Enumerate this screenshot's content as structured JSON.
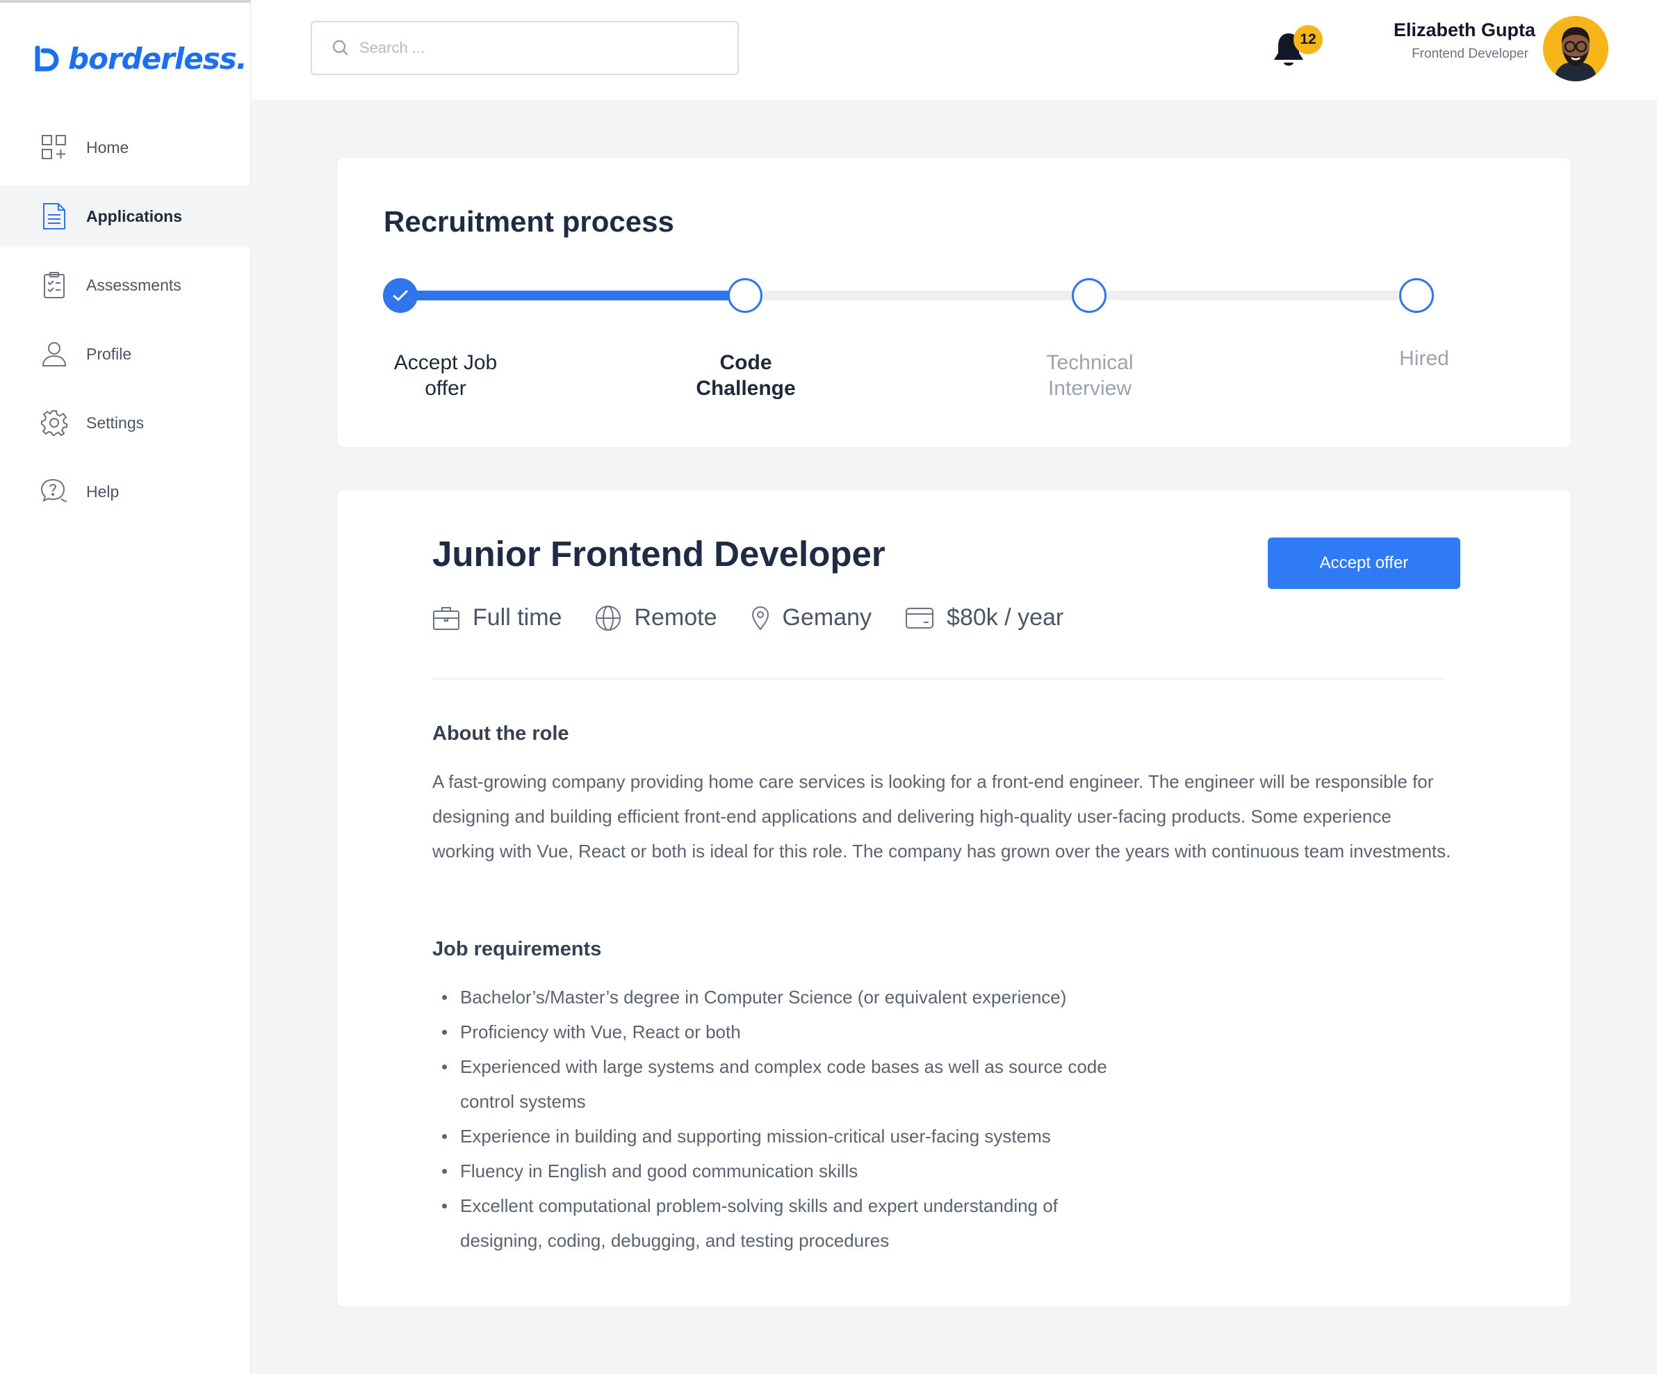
{
  "brand": {
    "name": "borderless.",
    "color": "#1d6ff2"
  },
  "search": {
    "placeholder": "Search ..."
  },
  "notifications": {
    "count": "12"
  },
  "user": {
    "name": "Elizabeth Gupta",
    "role": "Frontend Developer"
  },
  "sidebar": {
    "items": [
      {
        "label": "Home",
        "icon": "grid-icon",
        "active": false
      },
      {
        "label": "Applications",
        "icon": "document-icon",
        "active": true
      },
      {
        "label": "Assessments",
        "icon": "clipboard-icon",
        "active": false
      },
      {
        "label": "Profile",
        "icon": "user-icon",
        "active": false
      },
      {
        "label": "Settings",
        "icon": "gear-icon",
        "active": false
      },
      {
        "label": "Help",
        "icon": "help-bubble-icon",
        "active": false
      }
    ]
  },
  "process": {
    "title": "Recruitment process",
    "progress": 0.333,
    "steps": [
      {
        "label": "Accept Job offer",
        "status": "done"
      },
      {
        "label": "Code Challenge",
        "status": "current"
      },
      {
        "label": "Technical Interview",
        "status": "pending"
      },
      {
        "label": "Hired",
        "status": "pending"
      }
    ]
  },
  "job": {
    "title": "Junior Frontend Developer",
    "accept_label": "Accept offer",
    "meta": {
      "type": "Full time",
      "location_type": "Remote",
      "country": "Gemany",
      "salary": "$80k / year"
    },
    "about": {
      "heading": "About the role",
      "text": "A fast-growing company providing home care services is looking for a front-end engineer. The engineer will be responsible for designing and building efficient front-end applications and delivering high-quality user-facing products. Some experience working with Vue, React or both is ideal for this role. The company has grown over the years with continuous team investments."
    },
    "requirements": {
      "heading": "Job requirements",
      "items": [
        "Bachelor’s/Master’s degree in Computer Science (or equivalent experience)",
        "Proficiency with Vue, React or both",
        "Experienced with large systems and complex code bases as well as source code control systems",
        "Experience in building and supporting mission-critical user-facing systems",
        "Fluency in English and good communication skills",
        "Excellent computational problem-solving skills and expert understanding of designing, coding, debugging, and testing procedures"
      ]
    }
  },
  "colors": {
    "accent": "#2f76ec",
    "badge": "#f6b519",
    "background": "#f3f4f6"
  }
}
